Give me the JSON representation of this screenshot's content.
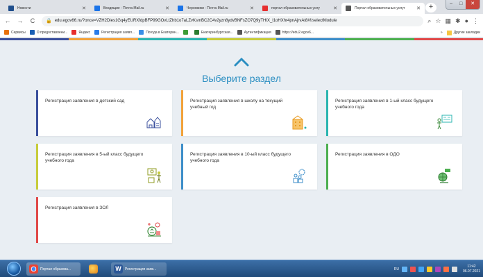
{
  "browser": {
    "tabs": [
      {
        "label": "Новости",
        "icon": "news-icon",
        "color": "#1f4e8c",
        "active": false
      },
      {
        "label": "Входящие - Почта Mail.ru",
        "icon": "mail-icon",
        "color": "#1a73e8",
        "active": false
      },
      {
        "label": "Черновики - Почта Mail.ru",
        "icon": "mail-icon",
        "color": "#1a73e8",
        "active": false
      },
      {
        "label": "портал образовательных услу",
        "icon": "yandex-icon",
        "color": "#e62e2e",
        "active": false
      },
      {
        "label": "Портал образовательных услуг",
        "icon": "globe-icon",
        "color": "#555555",
        "active": true
      }
    ],
    "url": "edu.egov66.ru/?once=VZH2Dies1Gq4yEURXfdpBFP99GOvLtZhb1o7aLZvKsmBC2C4v2yzn8ydvBNFsZO7Q9yTHIX_l1oHXhr4pnAjrvAt8#!/selectModule",
    "bookmarks": [
      {
        "label": "Сервисы",
        "color": "#e8710a"
      },
      {
        "label": "О предоставлени...",
        "color": "#1a5fb4"
      },
      {
        "label": "Яндекс",
        "color": "#e62e2e"
      },
      {
        "label": "Регистрация заявл...",
        "color": "#2b7de9"
      },
      {
        "label": "Погода в Екатерин...",
        "color": "#3a8ee6"
      },
      {
        "label": "",
        "color": "#3e9c35"
      },
      {
        "label": "Екатеринбургская...",
        "color": "#2e7d32"
      },
      {
        "label": "Аутентификация",
        "color": "#555555"
      },
      {
        "label": "https://edu2.egov6...",
        "color": "#555555"
      }
    ],
    "bookmarks_other": "Другие закладки"
  },
  "page": {
    "title": "Выберите раздел",
    "cards": [
      {
        "label": "Регистрация заявления в детский сад",
        "accent": "#3a4f9c",
        "icon": "kindergarten-icon"
      },
      {
        "label": "Регистрация заявления в школу на текущий учебный год",
        "accent": "#f2a23a",
        "icon": "school-building-icon"
      },
      {
        "label": "Регистрация заявления в 1-ый класс будущего учебного года",
        "accent": "#2ab5b0",
        "icon": "teacher-board-icon"
      },
      {
        "label": "Регистрация заявления в 5-ый класс будущего учебного года",
        "accent": "#c7cc3b",
        "icon": "classroom-icon"
      },
      {
        "label": "Регистрация заявления в 10-ый класс будущего учебного года",
        "accent": "#3d8ec9",
        "icon": "graduates-icon"
      },
      {
        "label": "Регистрация заявления в ОДО",
        "accent": "#4caf50",
        "icon": "globe-education-icon"
      },
      {
        "label": "Регистрация заявления в ЗОЛ",
        "accent": "#e04848",
        "icon": "summer-camp-icon"
      }
    ]
  },
  "taskbar": {
    "tasks": [
      {
        "label": "Портал образова...",
        "color": "#e0e7ef"
      },
      {
        "label": "",
        "color": "#f1b32e"
      },
      {
        "label": "Регистрация заяв...",
        "color": "#2b5797"
      }
    ],
    "lang": "RU",
    "time": "11:42",
    "date": "06.07.2021"
  }
}
